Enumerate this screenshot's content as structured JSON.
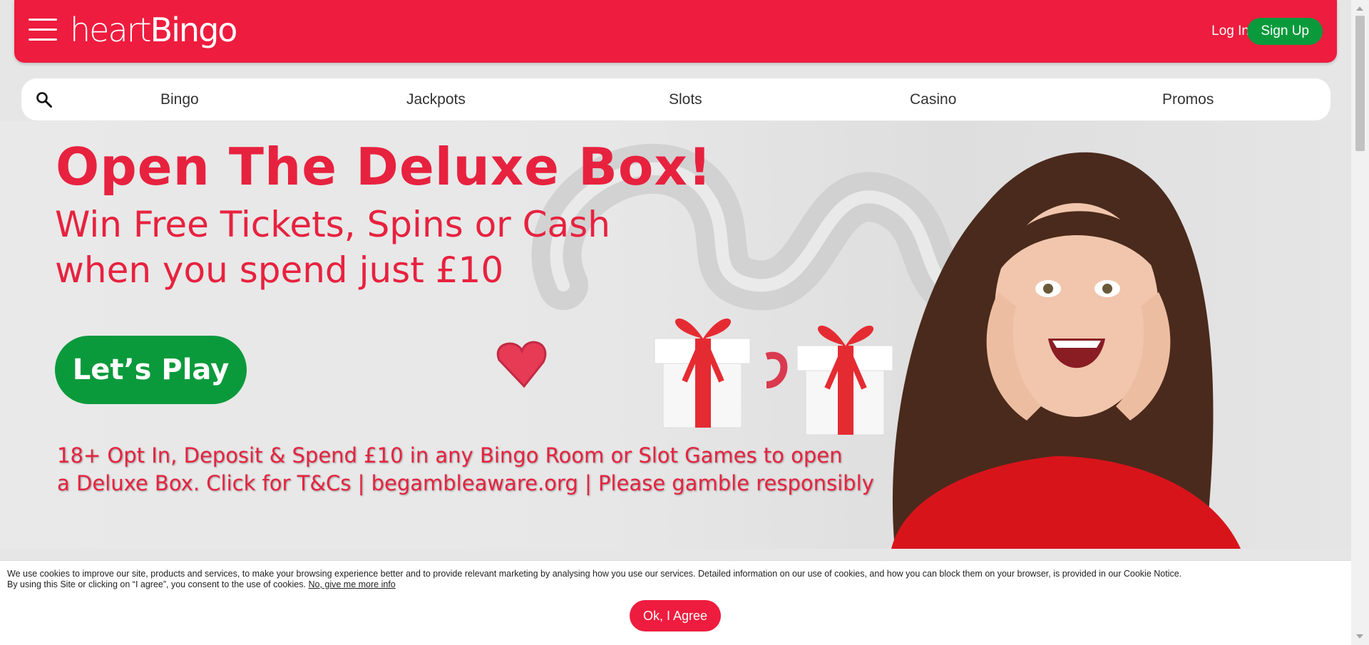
{
  "header": {
    "logo_part1": "heart",
    "logo_part2": "Bingo",
    "login_label": "Log In",
    "signup_label": "Sign Up"
  },
  "nav": {
    "items": [
      "Bingo",
      "Jackpots",
      "Slots",
      "Casino",
      "Promos"
    ]
  },
  "hero": {
    "title": "Open The Deluxe Box!",
    "subtitle_line1": "Win Free Tickets, Spins or Cash",
    "subtitle_line2": "when you spend just £10",
    "cta_label": "Let’s Play",
    "terms_line1": "18+ Opt In, Deposit & Spend £10 in any Bingo Room or Slot Games to open",
    "terms_line2": "a Deluxe Box. Click for T&Cs | begambleaware.org | Please gamble responsibly"
  },
  "cookie": {
    "line1": "We use cookies to improve our site, products and services, to make your browsing experience better and to provide relevant marketing by analysing how you use our services. Detailed information on our use of cookies, and how you can block them on your browser, is provided in our Cookie Notice.",
    "line2": "By using this Site or clicking on “I agree”, you consent to the use of cookies.",
    "link_label": "No, give me more info",
    "agree_label": "Ok, I Agree"
  },
  "colors": {
    "brand_red": "#ee1c3e",
    "cta_green": "#0a9a3c",
    "hero_text_red": "#e7223f"
  },
  "icons": {
    "menu": "hamburger-menu-icon",
    "search": "search-icon"
  }
}
